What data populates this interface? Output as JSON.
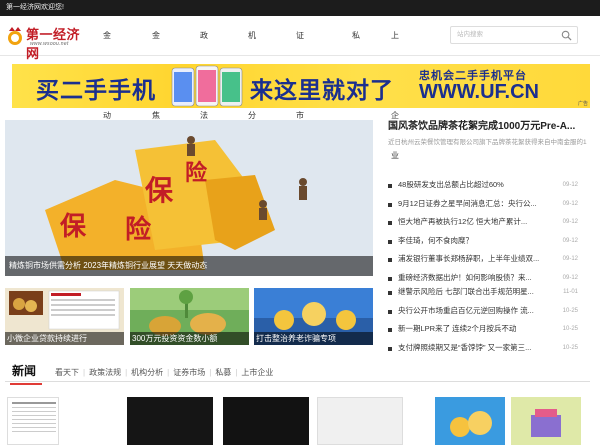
{
  "topbar": {
    "text": "第一经济网欢迎您!"
  },
  "logo": {
    "name": "第一经济网",
    "url": "www.wsoou.net"
  },
  "nav": {
    "items": [
      "金融动态",
      "金融焦点",
      "政策法规",
      "机构分析",
      "证券市场",
      "私募",
      "上市企业"
    ]
  },
  "search": {
    "placeholder": "站内搜索"
  },
  "banner": {
    "left_text": "买二手手机",
    "mid_text": "来这里就对了",
    "badge_text": "忠机会二手手机平台",
    "badge_url": "WWW.UF.CN",
    "ad_label": "广告"
  },
  "hero": {
    "image_text_1": "保",
    "image_text_2": "险",
    "caption": "精炼铜市场供需分析 2023年精炼铜行业展望 天天做动态"
  },
  "thumbs": [
    {
      "caption": "小微企业贷款持续进行"
    },
    {
      "caption": "300万元投资资金数小额"
    },
    {
      "caption": "打击整治养老诈骗专项"
    }
  ],
  "feature": {
    "headline": "国风茶饮品牌茶花絮完成1000万元Pre-A...",
    "summary": "近日杭州云荣餐饮管理有限公司旗下品牌茶花絮获得来自中南金服的1"
  },
  "news_group_1": [
    {
      "title": "48股研发支出总额占比超过60%",
      "date": "09-12"
    },
    {
      "title": "9月12日证券之星早间消息汇总：央行公...",
      "date": "09-12"
    },
    {
      "title": "恒大地产再被执行12亿 恒大地产累计...",
      "date": "09-12"
    },
    {
      "title": "李佳琦，何不食肉糜？",
      "date": "09-12"
    },
    {
      "title": "浦发银行董事长郑杨辞职，上半年业绩双...",
      "date": "09-12"
    },
    {
      "title": "重磅经济数据出炉！如何影响股债？来...",
      "date": "09-12"
    }
  ],
  "news_group_2": [
    {
      "title": "继警示风险后 七部门联合出手规范明星...",
      "date": "11-01"
    },
    {
      "title": "央行公开市场重启百亿元逆回购操作 流...",
      "date": "10-25"
    },
    {
      "title": "新一期LPR来了 连续2个月按兵不动",
      "date": "10-25"
    },
    {
      "title": "支付牌照续期又是“香饽饽” 又一家第三...",
      "date": "10-25"
    }
  ],
  "section": {
    "title": "新闻",
    "tabs": [
      "看天下",
      "政策法规",
      "机构分析",
      "证券市场",
      "私募",
      "上市企业"
    ]
  },
  "colors": {
    "brand_red": "#c21d26",
    "accent_red": "#e03b36",
    "banner_yellow": "#ffd52e",
    "banner_blue": "#1b2f8f",
    "topbar_bg": "#1c1c1c"
  }
}
